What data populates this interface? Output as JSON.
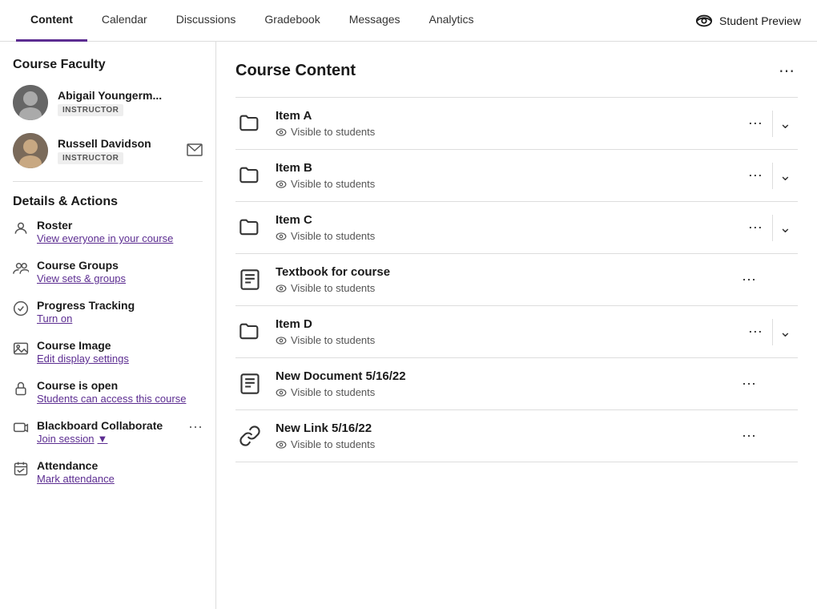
{
  "nav": {
    "tabs": [
      {
        "label": "Content",
        "active": true
      },
      {
        "label": "Calendar",
        "active": false
      },
      {
        "label": "Discussions",
        "active": false
      },
      {
        "label": "Gradebook",
        "active": false
      },
      {
        "label": "Messages",
        "active": false
      },
      {
        "label": "Analytics",
        "active": false
      }
    ],
    "student_preview_label": "Student Preview"
  },
  "sidebar": {
    "faculty_title": "Course Faculty",
    "instructors": [
      {
        "name": "Abigail Youngerm...",
        "role": "INSTRUCTOR",
        "has_mail": false
      },
      {
        "name": "Russell Davidson",
        "role": "INSTRUCTOR",
        "has_mail": true
      }
    ],
    "details_title": "Details & Actions",
    "actions": [
      {
        "icon": "roster-icon",
        "label": "Roster",
        "link": "View everyone in your course",
        "has_more": false
      },
      {
        "icon": "groups-icon",
        "label": "Course Groups",
        "link": "View sets & groups",
        "has_more": false
      },
      {
        "icon": "progress-icon",
        "label": "Progress Tracking",
        "link": "Turn on",
        "has_more": false
      },
      {
        "icon": "image-icon",
        "label": "Course Image",
        "link": "Edit display settings",
        "has_more": false
      },
      {
        "icon": "lock-icon",
        "label": "Course is open",
        "link": "Students can access this course",
        "has_more": false
      },
      {
        "icon": "collaborate-icon",
        "label": "Blackboard Collaborate",
        "link": "Join session",
        "link_has_arrow": true,
        "has_more": true
      },
      {
        "icon": "attendance-icon",
        "label": "Attendance",
        "link": "Mark attendance",
        "has_more": false
      }
    ]
  },
  "content": {
    "title": "Course Content",
    "items": [
      {
        "name": "Item A",
        "visibility": "Visible to students",
        "type": "folder",
        "has_chevron": true
      },
      {
        "name": "Item B",
        "visibility": "Visible to students",
        "type": "folder",
        "has_chevron": true
      },
      {
        "name": "Item C",
        "visibility": "Visible to students",
        "type": "folder",
        "has_chevron": true
      },
      {
        "name": "Textbook for course",
        "visibility": "Visible to students",
        "type": "doc",
        "has_chevron": false
      },
      {
        "name": "Item D",
        "visibility": "Visible to students",
        "type": "folder",
        "has_chevron": true
      },
      {
        "name": "New Document 5/16/22",
        "visibility": "Visible to students",
        "type": "doc",
        "has_chevron": false
      },
      {
        "name": "New Link 5/16/22",
        "visibility": "Visible to students",
        "type": "link",
        "has_chevron": false
      }
    ]
  }
}
